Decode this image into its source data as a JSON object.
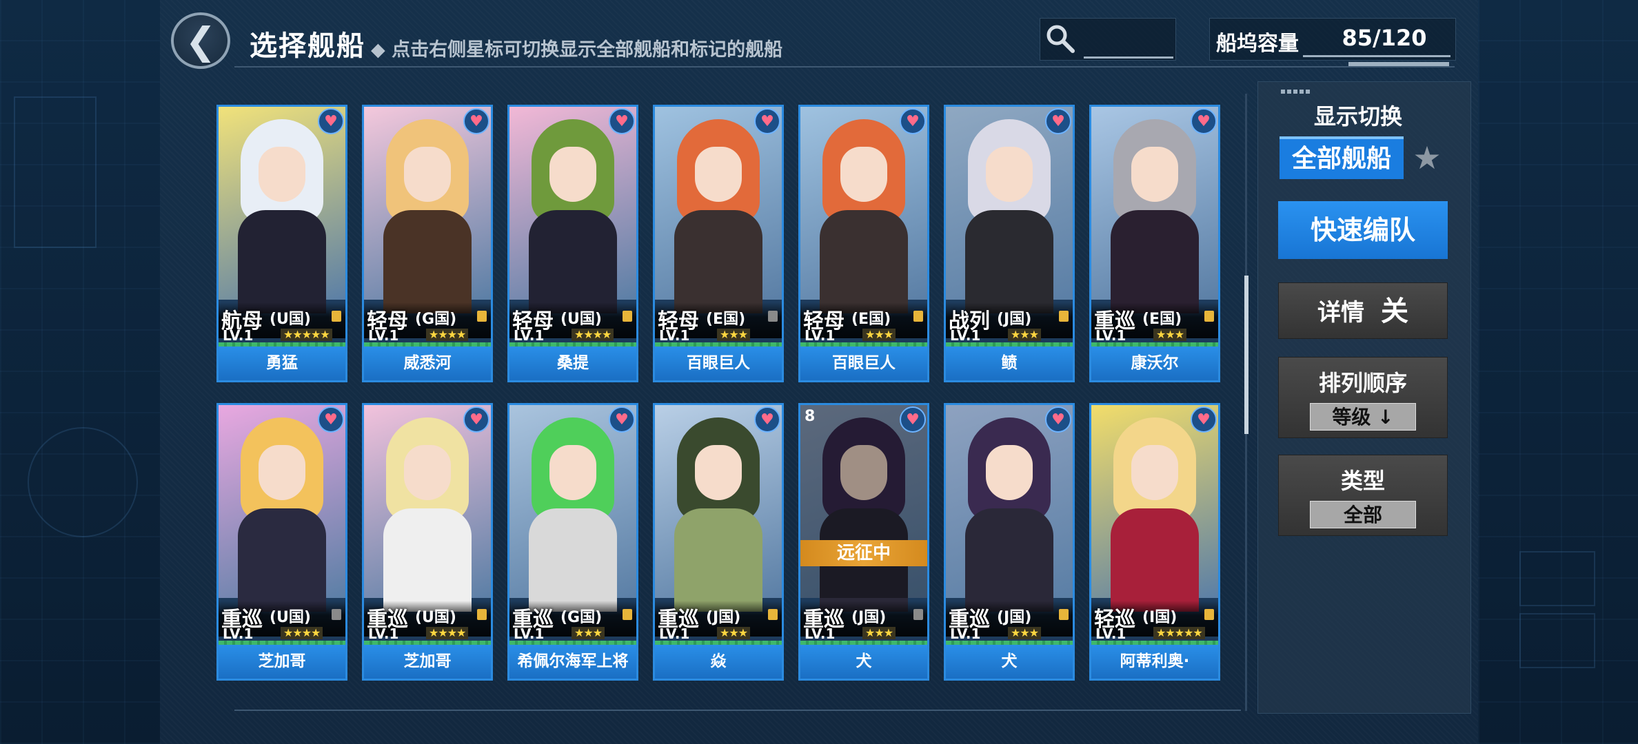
{
  "header": {
    "back_icon": "chevron-left-icon",
    "title": "选择舰船",
    "subtitle": "◆ 点击右侧星标可切换显示全部舰船和标记的舰船",
    "search_icon": "search-icon",
    "dock_label": "船坞容量",
    "dock_value": "85/120"
  },
  "sidebar": {
    "display_label": "显示切换",
    "all_ships": "全部舰船",
    "star_toggle": "★",
    "quick_form": "快速编队",
    "details_label": "详情",
    "details_value": "关",
    "order_label": "排列顺序",
    "order_value": "等级 ↓",
    "type_label": "类型",
    "type_value": "全部"
  },
  "cards": [
    {
      "type": "航母",
      "nation": "(U国)",
      "lvl": "LV.1",
      "stars": "★★★★★",
      "name": "勇猛",
      "lock": "#e8b53a",
      "bg": "#f1e27a",
      "hair": "#e8eef6",
      "outfit": "#222233"
    },
    {
      "type": "轻母",
      "nation": "(G国)",
      "lvl": "LV.1",
      "stars": "★★★★",
      "name": "威悉河",
      "lock": "#e8b53a",
      "bg": "#f4c8dc",
      "hair": "#f0c37a",
      "outfit": "#4a3326"
    },
    {
      "type": "轻母",
      "nation": "(U国)",
      "lvl": "LV.1",
      "stars": "★★★★",
      "name": "桑提",
      "lock": "#e8b53a",
      "bg": "#f2b8d6",
      "hair": "#6f9a3c",
      "outfit": "#222233"
    },
    {
      "type": "轻母",
      "nation": "(E国)",
      "lvl": "LV.1",
      "stars": "★★★",
      "name": "百眼巨人",
      "lock": "#8a8a8a",
      "bg": "#9fc2e0",
      "hair": "#e26a3a",
      "outfit": "#3a3030"
    },
    {
      "type": "轻母",
      "nation": "(E国)",
      "lvl": "LV.1",
      "stars": "★★★",
      "name": "百眼巨人",
      "lock": "#e8b53a",
      "bg": "#9fc2e0",
      "hair": "#e26a3a",
      "outfit": "#3a3030"
    },
    {
      "type": "战列",
      "nation": "(J国)",
      "lvl": "LV.1",
      "stars": "★★★",
      "name": "鲼",
      "lock": "#e8b53a",
      "bg": "#8fa8c2",
      "hair": "#d9d9e6",
      "outfit": "#2a2a30"
    },
    {
      "type": "重巡",
      "nation": "(E国)",
      "lvl": "LV.1",
      "stars": "★★★",
      "name": "康沃尔",
      "lock": "#e8b53a",
      "bg": "#a9c6e4",
      "hair": "#a8a8b0",
      "outfit": "#2a2030"
    },
    {
      "type": "重巡",
      "nation": "(U国)",
      "lvl": "LV.1",
      "stars": "★★★★",
      "name": "芝加哥",
      "lock": "#8a8a8a",
      "bg": "#e9a8e0",
      "hair": "#f3c25c",
      "outfit": "#2a2a40"
    },
    {
      "type": "重巡",
      "nation": "(U国)",
      "lvl": "LV.1",
      "stars": "★★★★",
      "name": "芝加哥",
      "lock": "#e8b53a",
      "bg": "#f2c2dc",
      "hair": "#f0e2a2",
      "outfit": "#efefef"
    },
    {
      "type": "重巡",
      "nation": "(G国)",
      "lvl": "LV.1",
      "stars": "★★★",
      "name": "希佩尔海军上将",
      "lock": "#e8b53a",
      "bg": "#aac4de",
      "hair": "#4fcf5a",
      "outfit": "#d9d9d9"
    },
    {
      "type": "重巡",
      "nation": "(J国)",
      "lvl": "LV.1",
      "stars": "★★★",
      "name": "焱",
      "lock": "#e8b53a",
      "bg": "#b9cfe6",
      "hair": "#3a4a2e",
      "outfit": "#8fa36a"
    },
    {
      "type": "重巡",
      "nation": "(J国)",
      "lvl": "LV.1",
      "stars": "★★★",
      "name": "犬",
      "lock": "#8a8a8a",
      "bg": "#8ea2c0",
      "hair": "#3a2a50",
      "outfit": "#2a2838",
      "expedition": "远征中",
      "level_num": "8"
    },
    {
      "type": "重巡",
      "nation": "(J国)",
      "lvl": "LV.1",
      "stars": "★★★",
      "name": "犬",
      "lock": "#e8b53a",
      "bg": "#8ea2c0",
      "hair": "#3a2a50",
      "outfit": "#2a2838"
    },
    {
      "type": "轻巡",
      "nation": "(I国)",
      "lvl": "LV.1",
      "stars": "★★★★★",
      "name": "阿蒂利奥·",
      "lock": "#e8b53a",
      "bg": "#f2dd6a",
      "hair": "#f3d68a",
      "outfit": "#a8203a"
    }
  ]
}
